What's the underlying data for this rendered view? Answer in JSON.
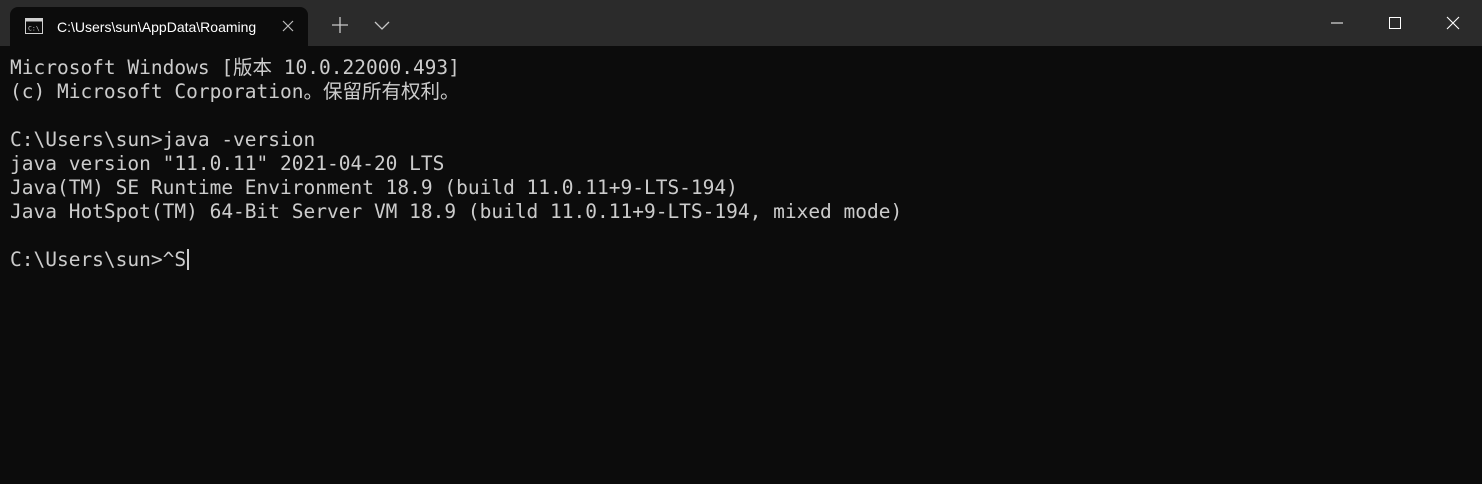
{
  "window": {
    "tab_title": "C:\\Users\\sun\\AppData\\Roaming",
    "icons": {
      "tab": "cmd-icon",
      "tab_close": "close-icon",
      "new_tab": "plus-icon",
      "dropdown": "chevron-down-icon",
      "minimize": "minimize-icon",
      "maximize": "maximize-icon",
      "close": "close-icon"
    }
  },
  "console": {
    "lines": [
      "Microsoft Windows [版本 10.0.22000.493]",
      "(c) Microsoft Corporation。保留所有权利。",
      "",
      "C:\\Users\\sun>java -version",
      "java version \"11.0.11\" 2021-04-20 LTS",
      "Java(TM) SE Runtime Environment 18.9 (build 11.0.11+9-LTS-194)",
      "Java HotSpot(TM) 64-Bit Server VM 18.9 (build 11.0.11+9-LTS-194, mixed mode)",
      ""
    ],
    "prompt": "C:\\Users\\sun>",
    "current_input": "^S"
  },
  "colors": {
    "titlebar": "#2b2b2b",
    "console_bg": "#0c0c0c",
    "console_text": "#cccccc"
  }
}
